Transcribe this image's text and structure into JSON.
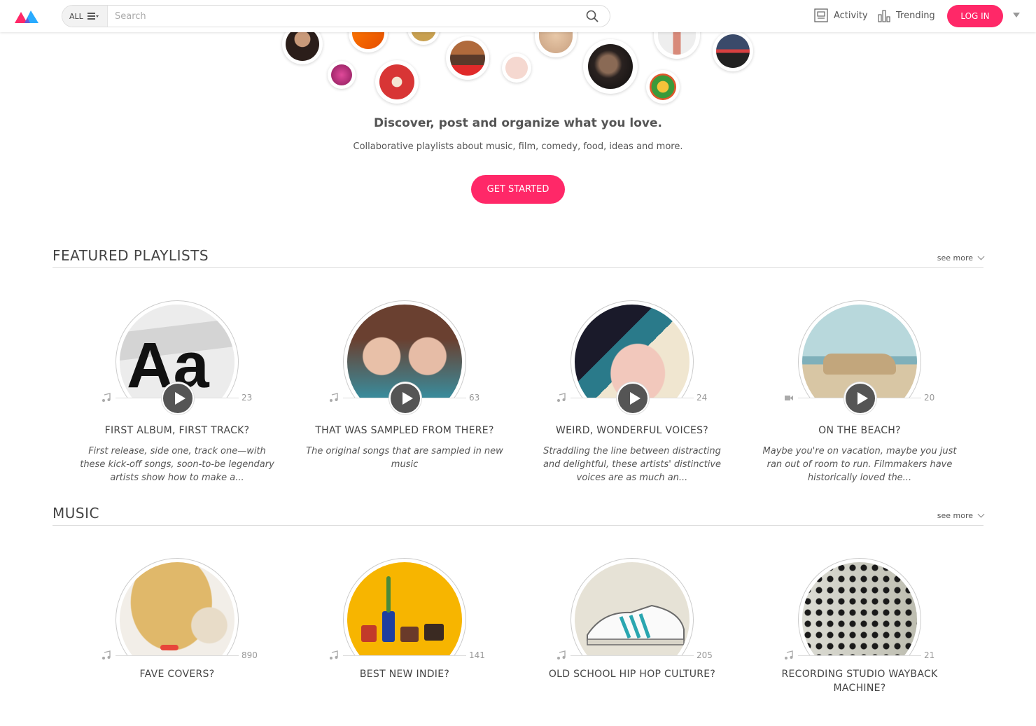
{
  "header": {
    "search_scope": "ALL",
    "search_placeholder": "Search",
    "nav": [
      {
        "label": "Activity",
        "icon": "activity-icon"
      },
      {
        "label": "Trending",
        "icon": "trending-icon"
      }
    ],
    "login_label": "LOG IN"
  },
  "hero": {
    "tagline": "Discover, post and organize what you love.",
    "subline": "Collaborative playlists about music, film, comedy, food, ideas and more.",
    "cta_label": "GET STARTED"
  },
  "sections": [
    {
      "title": "FEATURED PLAYLISTS",
      "see_more": "see more",
      "cards": [
        {
          "title": "FIRST ALBUM, FIRST TRACK?",
          "count": "23",
          "type": "music",
          "desc": "First release, side one, track one—with these kick-off songs, soon-to-be legendary artists show how to make a..."
        },
        {
          "title": "THAT WAS SAMPLED FROM THERE?",
          "count": "63",
          "type": "music",
          "desc": "The original songs that are sampled in new music"
        },
        {
          "title": "WEIRD, WONDERFUL VOICES?",
          "count": "24",
          "type": "music",
          "desc": "Straddling the line between distracting and delightful, these artists' distinctive voices are as much an..."
        },
        {
          "title": "ON THE BEACH?",
          "count": "20",
          "type": "video",
          "desc": "Maybe you're on vacation, maybe you just ran out of room to run. Filmmakers have historically loved the..."
        }
      ]
    },
    {
      "title": "MUSIC",
      "see_more": "see more",
      "cards": [
        {
          "title": "FAVE COVERS?",
          "count": "890",
          "type": "music"
        },
        {
          "title": "BEST NEW INDIE?",
          "count": "141",
          "type": "music"
        },
        {
          "title": "OLD SCHOOL HIP HOP CULTURE?",
          "count": "205",
          "type": "music"
        },
        {
          "title": "RECORDING STUDIO WAYBACK MACHINE?",
          "count": "21",
          "type": "music"
        }
      ]
    }
  ],
  "colors": {
    "accent": "#ff2868",
    "logo_blue": "#1ea7ff",
    "logo_pink": "#ff2868"
  }
}
